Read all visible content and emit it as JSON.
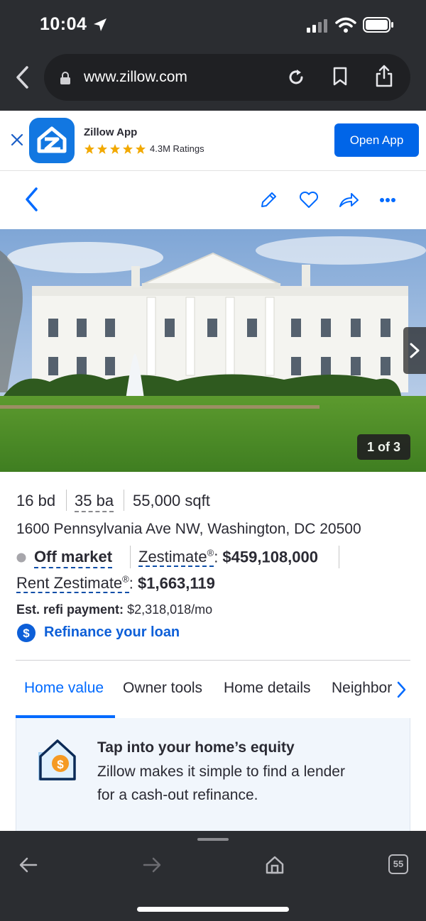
{
  "status_bar": {
    "time": "10:04"
  },
  "browser": {
    "url": "www.zillow.com",
    "tab_count": "55"
  },
  "app_banner": {
    "name": "Zillow App",
    "ratings": "4.3M Ratings",
    "open_label": "Open App"
  },
  "photo": {
    "counter": "1 of 3"
  },
  "facts": {
    "beds": "16 bd",
    "baths": "35 ba",
    "sqft": "55,000 sqft",
    "address": "1600 Pennsylvania Ave NW, Washington, DC 20500",
    "status": "Off market",
    "zestimate_label": "Zestimate",
    "zestimate_value": "$459,108,000",
    "rent_label": "Rent Zestimate",
    "rent_value": "$1,663,119",
    "refi_label": "Est. refi payment:",
    "refi_value": "$2,318,018/mo",
    "refinance_link": "Refinance your loan"
  },
  "tabs": [
    {
      "label": "Home value",
      "active": true
    },
    {
      "label": "Owner tools",
      "active": false
    },
    {
      "label": "Home details",
      "active": false
    },
    {
      "label": "Neighbor",
      "active": false
    }
  ],
  "equity_card": {
    "title": "Tap into your home’s equity",
    "body_line1": "Zillow makes it simple to find a lender",
    "body_line2": "for a cash-out refinance."
  },
  "colors": {
    "accent": "#006aff",
    "link": "#0d4ea8",
    "chrome": "#2b2d31",
    "star": "#f2a900",
    "status_gray": "#a7a6ab"
  }
}
